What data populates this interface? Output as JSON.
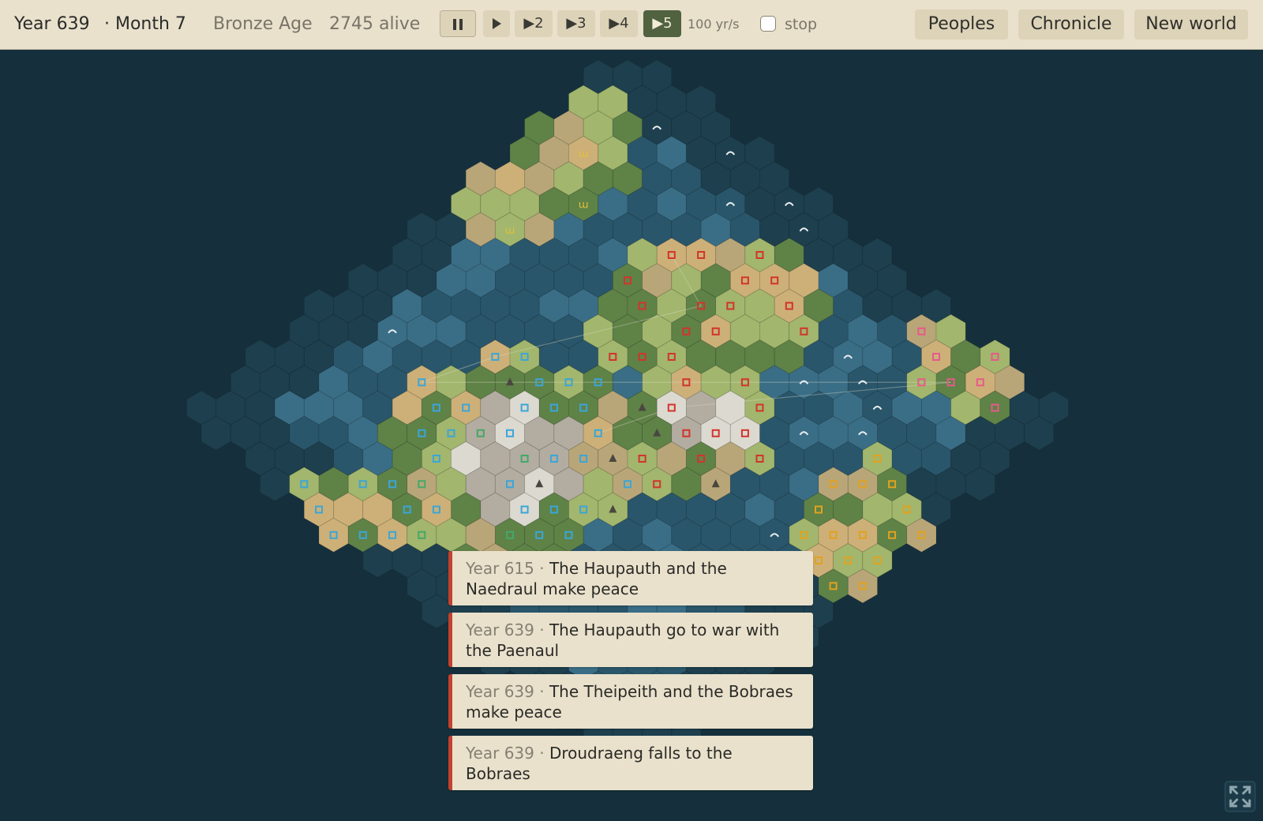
{
  "topbar": {
    "year": "Year 639",
    "month": "· Month 7",
    "age": "Bronze Age",
    "alive": "2745 alive",
    "controls": {
      "pause_icon": "pause-icon",
      "play_icon": "play-icon",
      "speed2": "▶2",
      "speed3": "▶3",
      "speed4": "▶4",
      "speed5": "▶5",
      "active_speed": "▶5"
    },
    "rate": "100 yr/s",
    "stop_label": "stop",
    "stop_checked": false,
    "buttons": {
      "peoples": "Peoples",
      "chronicle": "Chronicle",
      "new_world": "New world"
    }
  },
  "events": [
    {
      "year": "Year 615",
      "sep": " · ",
      "text": "The Haupauth and the Naedraul make peace"
    },
    {
      "year": "Year 639",
      "sep": " · ",
      "text": "The Haupauth go to war with the Paenaul"
    },
    {
      "year": "Year 639",
      "sep": " · ",
      "text": "The Theipeith and the Bobraes make peace"
    },
    {
      "year": "Year 639",
      "sep": " · ",
      "text": "Droudraeng falls to the Bobraes"
    }
  ],
  "map": {
    "background": "#15303c",
    "colors": {
      "deep_ocean": "#1e3f4e",
      "ocean": "#2a566b",
      "shallow": "#3a6e86",
      "grassland": "#a2b66d",
      "forest": "#5f8247",
      "desert": "#cdb078",
      "hills": "#b9a678",
      "mountain": "#b3aca0",
      "snow": "#dcd9d0",
      "pink_people": "#e65a8a",
      "blue_people": "#3aa6d8",
      "green_people": "#44a86a",
      "red_people": "#d2342c",
      "gold_people": "#e2a21f"
    },
    "icons": [
      "wheat-icon",
      "wave-icon",
      "settlement-icon",
      "mountain-peak-icon",
      "trade-route-line"
    ]
  },
  "expand_icon": "expand-icon"
}
